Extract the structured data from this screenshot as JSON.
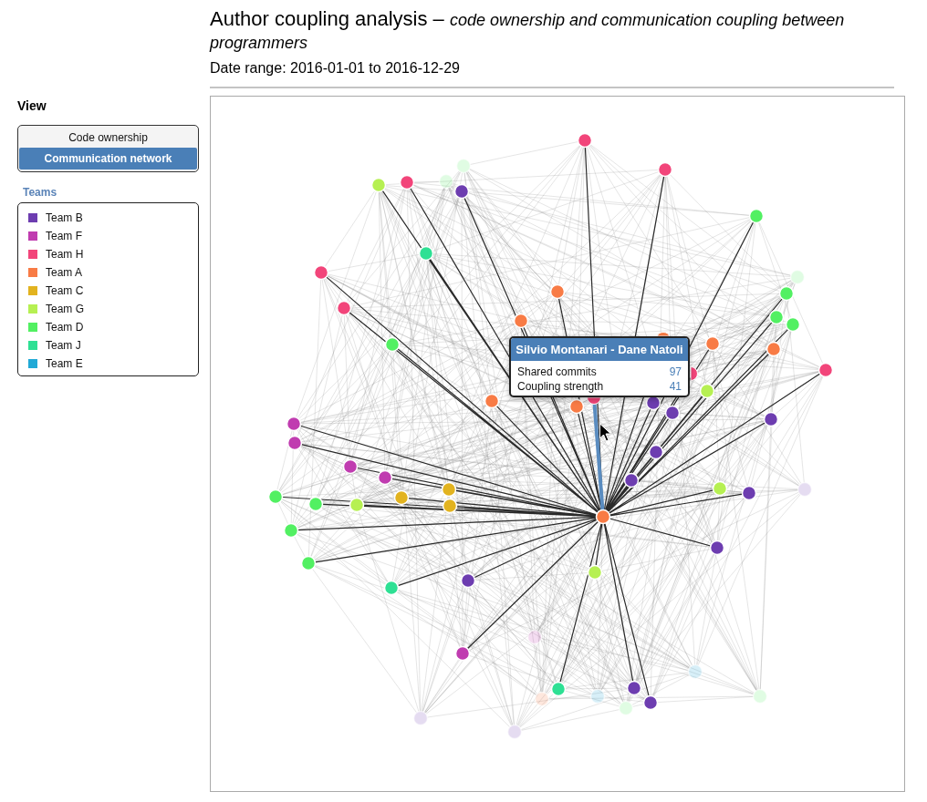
{
  "header": {
    "title": "Author coupling analysis – *code ownership and communication coupling between programmers*",
    "date_range": "Date range: 2016-01-01 to 2016-12-29"
  },
  "sidebar": {
    "view_heading": "View",
    "view_options": [
      {
        "label": "Code ownership",
        "selected": false
      },
      {
        "label": "Communication network",
        "selected": true
      }
    ],
    "teams_heading": "Teams",
    "teams": [
      {
        "name": "Team B",
        "color": "#6d3db0"
      },
      {
        "name": "Team F",
        "color": "#c03cb0"
      },
      {
        "name": "Team H",
        "color": "#f2457a"
      },
      {
        "name": "Team A",
        "color": "#f87b45"
      },
      {
        "name": "Team C",
        "color": "#e2b31f"
      },
      {
        "name": "Team G",
        "color": "#b6f052"
      },
      {
        "name": "Team D",
        "color": "#52f062"
      },
      {
        "name": "Team J",
        "color": "#2ee094"
      },
      {
        "name": "Team E",
        "color": "#21a9d6"
      }
    ]
  },
  "graph": {
    "tooltip": {
      "title": "Silvio Montanari - Dane Natoli",
      "rows": [
        {
          "label": "Shared commits",
          "value": "97"
        },
        {
          "label": "Coupling strength",
          "value": "41"
        }
      ]
    }
  }
}
